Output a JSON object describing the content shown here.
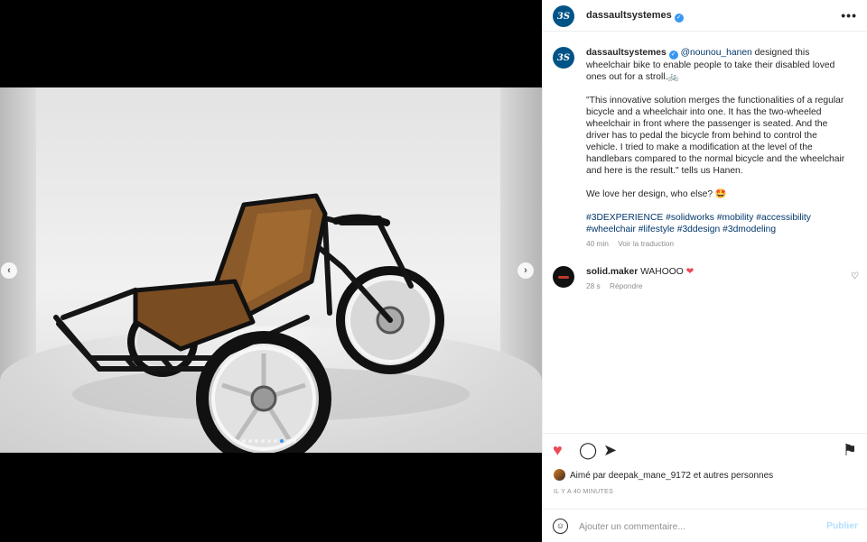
{
  "post": {
    "account": "dassaultsystemes",
    "avatar_text": "3S",
    "verified_mark": "✓",
    "more_label": "•••"
  },
  "media": {
    "prev_label": "‹",
    "next_label": "›",
    "slide_count": 9,
    "active_slide": 7
  },
  "caption": {
    "author": "dassaultsystemes",
    "mention": "@nounou_hanen",
    "intro": " designed this wheelchair bike to enable people to take their disabled loved ones out for a stroll.🚲",
    "quote": "\"This innovative solution merges the functionalities of a regular bicycle and a wheelchair into one. It has the two-wheeled wheelchair in front where the passenger is seated. And the driver has to pedal the bicycle from behind to control the vehicle. I tried to make a modification at the level of the handlebars compared to the normal bicycle and the wheelchair and here is the result.\" tells us Hanen.",
    "love": "We love her design, who else? 🤩",
    "hashtags": "#3DEXPERIENCE #solidworks #mobility #accessibility #wheelchair #lifestyle #3ddesign #3dmodeling",
    "time": "40 min",
    "translate": "Voir la traduction"
  },
  "comment": {
    "user": "solid.maker",
    "text": " WAHOOO ",
    "emoji": "❤",
    "time": "28 s",
    "reply": "Répondre",
    "like_icon": "♡"
  },
  "actions": {
    "like": "♥",
    "comment": "◯",
    "share": "➤",
    "save": "⚑"
  },
  "likes": {
    "text": "Aimé par deepak_mane_9172 et autres personnes"
  },
  "timestamp": "IL Y A 40 MINUTES",
  "add_comment": {
    "emoji": "☺",
    "placeholder": "Ajouter un commentaire...",
    "publish": "Publier"
  },
  "colors": {
    "accent": "#3897f0",
    "like": "#ed4956",
    "link": "#00376b",
    "publish_disabled": "#b2dffc"
  }
}
